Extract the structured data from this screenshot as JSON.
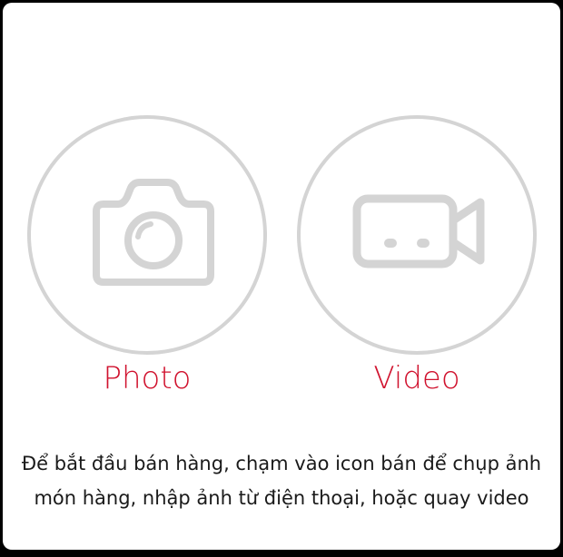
{
  "dialog": {
    "options": [
      {
        "label": "Photo",
        "icon": "camera-icon"
      },
      {
        "label": "Video",
        "icon": "video-camera-icon"
      }
    ],
    "instructions_line1": "Để bắt đầu bán hàng, chạm vào icon bán để chụp ảnh",
    "instructions_line2": "món hàng, nhập  ảnh từ điện thoại, hoặc quay video"
  },
  "colors": {
    "accent": "#d0122e",
    "icon_gray": "#d4d4d4",
    "background": "#ffffff",
    "backdrop": "#000000"
  }
}
